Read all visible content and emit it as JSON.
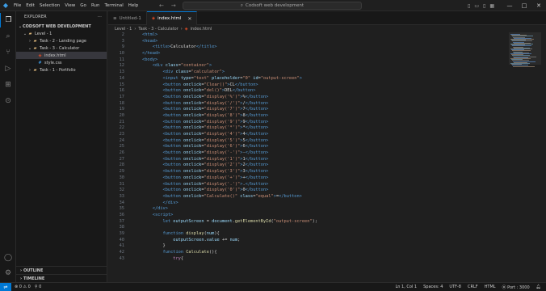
{
  "window": {
    "menu": [
      "File",
      "Edit",
      "Selection",
      "View",
      "Go",
      "Run",
      "Terminal",
      "Help"
    ],
    "search_text": "Codsoft web development"
  },
  "activity": [
    "files-icon",
    "search-icon",
    "source-control-icon",
    "run-debug-icon",
    "extensions-icon",
    "remote-explorer-icon"
  ],
  "sidebar": {
    "title": "EXPLORER",
    "workspace": "CODSOFT WEB DEVELOPMENT",
    "tree": [
      {
        "label": "Level - 1",
        "depth": 1,
        "type": "folder-open"
      },
      {
        "label": "Task - 2 - Landing page",
        "depth": 2,
        "type": "folder"
      },
      {
        "label": "Task - 3 - Calculator",
        "depth": 2,
        "type": "folder-open"
      },
      {
        "label": "index.html",
        "depth": 3,
        "type": "html",
        "selected": true
      },
      {
        "label": "style.css",
        "depth": 3,
        "type": "css"
      },
      {
        "label": "Task - 1 - Portfolio",
        "depth": 2,
        "type": "folder"
      }
    ],
    "outline": "OUTLINE",
    "timeline": "TIMELINE"
  },
  "tabs": [
    {
      "label": "Untitled-1",
      "active": false
    },
    {
      "label": "index.html",
      "active": true
    }
  ],
  "breadcrumb": [
    "Level - 1",
    "Task - 3 - Calculator",
    "index.html"
  ],
  "code_lines": [
    {
      "n": "2",
      "html": "<span class='t-tag'>&lt;html&gt;</span>"
    },
    {
      "n": "3",
      "html": "<span class='t-tag'>&lt;head&gt;</span>"
    },
    {
      "n": "9",
      "html": "    <span class='t-tag'>&lt;title&gt;</span><span class='t-txt'>Calculator</span><span class='t-tag'>&lt;/title&gt;</span>"
    },
    {
      "n": "10",
      "html": "<span class='t-tag'>&lt;/head&gt;</span>"
    },
    {
      "n": "11",
      "html": "<span class='t-tag'>&lt;body&gt;</span>"
    },
    {
      "n": "12",
      "html": "    <span class='t-tag'>&lt;div</span> <span class='t-attr'>class</span>=<span class='t-str'>\"container\"</span><span class='t-tag'>&gt;</span>"
    },
    {
      "n": "13",
      "html": "        <span class='t-tag'>&lt;div</span> <span class='t-attr'>class</span>=<span class='t-str'>\"calculator\"</span><span class='t-tag'>&gt;</span>"
    },
    {
      "n": "14",
      "html": "        <span class='t-tag'>&lt;input</span> <span class='t-attr'>type</span>=<span class='t-str'>\"text\"</span> <span class='t-attr'>placeholder</span>=<span class='t-str'>\"0\"</span> <span class='t-attr'>id</span>=<span class='t-str'>\"output-screen\"</span><span class='t-tag'>&gt;</span>"
    },
    {
      "n": "15",
      "html": "        <span class='t-tag'>&lt;button</span> <span class='t-attr'>onclick</span>=<span class='t-str'>\"Clear()\"</span><span class='t-tag'>&gt;</span><span class='t-txt'>CL</span><span class='t-tag'>&lt;/button&gt;</span>"
    },
    {
      "n": "16",
      "html": "        <span class='t-tag'>&lt;button</span> <span class='t-attr'>onclick</span>=<span class='t-str'>\"del()\"</span><span class='t-tag'>&gt;</span><span class='t-txt'>DEL</span><span class='t-tag'>&lt;/button&gt;</span>"
    },
    {
      "n": "17",
      "html": "        <span class='t-tag'>&lt;button</span> <span class='t-attr'>onclick</span>=<span class='t-str'>\"display('%')\"</span><span class='t-tag'>&gt;</span><span class='t-txt'>%</span><span class='t-tag'>&lt;/button&gt;</span>"
    },
    {
      "n": "18",
      "html": "        <span class='t-tag'>&lt;button</span> <span class='t-attr'>onclick</span>=<span class='t-str'>\"display('/')\"</span><span class='t-tag'>&gt;</span><span class='t-txt'>/</span><span class='t-tag'>&lt;/button&gt;</span>"
    },
    {
      "n": "19",
      "html": "        <span class='t-tag'>&lt;button</span> <span class='t-attr'>onclick</span>=<span class='t-str'>\"display('7')\"</span><span class='t-tag'>&gt;</span><span class='t-txt'>7</span><span class='t-tag'>&lt;/button&gt;</span>"
    },
    {
      "n": "20",
      "html": "        <span class='t-tag'>&lt;button</span> <span class='t-attr'>onclick</span>=<span class='t-str'>\"display('8')\"</span><span class='t-tag'>&gt;</span><span class='t-txt'>8</span><span class='t-tag'>&lt;/button&gt;</span>"
    },
    {
      "n": "21",
      "html": "        <span class='t-tag'>&lt;button</span> <span class='t-attr'>onclick</span>=<span class='t-str'>\"display('9')\"</span><span class='t-tag'>&gt;</span><span class='t-txt'>9</span><span class='t-tag'>&lt;/button&gt;</span>"
    },
    {
      "n": "22",
      "html": "        <span class='t-tag'>&lt;button</span> <span class='t-attr'>onclick</span>=<span class='t-str'>\"display('*')\"</span><span class='t-tag'>&gt;</span><span class='t-txt'>*</span><span class='t-tag'>&lt;/button&gt;</span>"
    },
    {
      "n": "23",
      "html": "        <span class='t-tag'>&lt;button</span> <span class='t-attr'>onclick</span>=<span class='t-str'>\"display('4')\"</span><span class='t-tag'>&gt;</span><span class='t-txt'>4</span><span class='t-tag'>&lt;/button&gt;</span>"
    },
    {
      "n": "24",
      "html": "        <span class='t-tag'>&lt;button</span> <span class='t-attr'>onclick</span>=<span class='t-str'>\"display('5')\"</span><span class='t-tag'>&gt;</span><span class='t-txt'>5</span><span class='t-tag'>&lt;/button&gt;</span>"
    },
    {
      "n": "25",
      "html": "        <span class='t-tag'>&lt;button</span> <span class='t-attr'>onclick</span>=<span class='t-str'>\"display('6')\"</span><span class='t-tag'>&gt;</span><span class='t-txt'>6</span><span class='t-tag'>&lt;/button&gt;</span>"
    },
    {
      "n": "26",
      "html": "        <span class='t-tag'>&lt;button</span> <span class='t-attr'>onclick</span>=<span class='t-str'>\"display('-')\"</span><span class='t-tag'>&gt;</span><span class='t-txt'>-</span><span class='t-tag'>&lt;/button&gt;</span>"
    },
    {
      "n": "27",
      "html": "        <span class='t-tag'>&lt;button</span> <span class='t-attr'>onclick</span>=<span class='t-str'>\"display('1')\"</span><span class='t-tag'>&gt;</span><span class='t-txt'>1</span><span class='t-tag'>&lt;/button&gt;</span>"
    },
    {
      "n": "28",
      "html": "        <span class='t-tag'>&lt;button</span> <span class='t-attr'>onclick</span>=<span class='t-str'>\"display('2')\"</span><span class='t-tag'>&gt;</span><span class='t-txt'>2</span><span class='t-tag'>&lt;/button&gt;</span>"
    },
    {
      "n": "29",
      "html": "        <span class='t-tag'>&lt;button</span> <span class='t-attr'>onclick</span>=<span class='t-str'>\"display('3')\"</span><span class='t-tag'>&gt;</span><span class='t-txt'>3</span><span class='t-tag'>&lt;/button&gt;</span>"
    },
    {
      "n": "30",
      "html": "        <span class='t-tag'>&lt;button</span> <span class='t-attr'>onclick</span>=<span class='t-str'>\"display('+')\"</span><span class='t-tag'>&gt;</span><span class='t-txt'>+</span><span class='t-tag'>&lt;/button&gt;</span>"
    },
    {
      "n": "31",
      "html": "        <span class='t-tag'>&lt;button</span> <span class='t-attr'>onclick</span>=<span class='t-str'>\"display('.')\"</span><span class='t-tag'>&gt;</span><span class='t-txt'>.</span><span class='t-tag'>&lt;/button&gt;</span>"
    },
    {
      "n": "32",
      "html": "        <span class='t-tag'>&lt;button</span> <span class='t-attr'>onclick</span>=<span class='t-str'>\"display('0')\"</span><span class='t-tag'>&gt;</span><span class='t-txt'>0</span><span class='t-tag'>&lt;/button&gt;</span>"
    },
    {
      "n": "33",
      "html": "        <span class='t-tag'>&lt;button</span> <span class='t-attr'>onclick</span>=<span class='t-str'>\"Calculate()\"</span> <span class='t-attr'>class</span>=<span class='t-str'>\"equal\"</span><span class='t-tag'>&gt;</span><span class='t-txt'>=</span><span class='t-tag'>&lt;/button&gt;</span>"
    },
    {
      "n": "34",
      "html": "        <span class='t-tag'>&lt;/div&gt;</span>"
    },
    {
      "n": "35",
      "html": "    <span class='t-tag'>&lt;/div&gt;</span>"
    },
    {
      "n": "36",
      "html": "    <span class='t-tag'>&lt;script&gt;</span>"
    },
    {
      "n": "37",
      "html": "        <span class='t-kw'>let</span> <span class='t-var'>outputScreen</span> = <span class='t-var'>document</span>.<span class='t-fn'>getElementById</span>(<span class='t-str'>\"output-screen\"</span>);"
    },
    {
      "n": "38",
      "html": ""
    },
    {
      "n": "39",
      "html": "        <span class='t-kw'>function</span> <span class='t-fn'>display</span>(<span class='t-var'>num</span>){"
    },
    {
      "n": "40",
      "html": "            <span class='t-var'>outputScreen</span>.<span class='t-var'>value</span> += <span class='t-var'>num</span>;"
    },
    {
      "n": "41",
      "html": "        }"
    },
    {
      "n": "42",
      "html": "        <span class='t-kw'>function</span> <span class='t-fn'>Calculate</span>(){"
    },
    {
      "n": "43",
      "html": "            <span class='t-ctl'>try</span>{"
    }
  ],
  "statusbar": {
    "errors": "0",
    "warnings": "0",
    "ports": "0",
    "position": "Ln 1, Col 1",
    "spaces": "Spaces: 4",
    "encoding": "UTF-8",
    "eol": "CRLF",
    "language": "HTML",
    "port": "Port : 3000"
  },
  "colors": {
    "accent": "#0078d4",
    "html_icon": "#e44d26",
    "css_icon": "#42a5f5"
  }
}
